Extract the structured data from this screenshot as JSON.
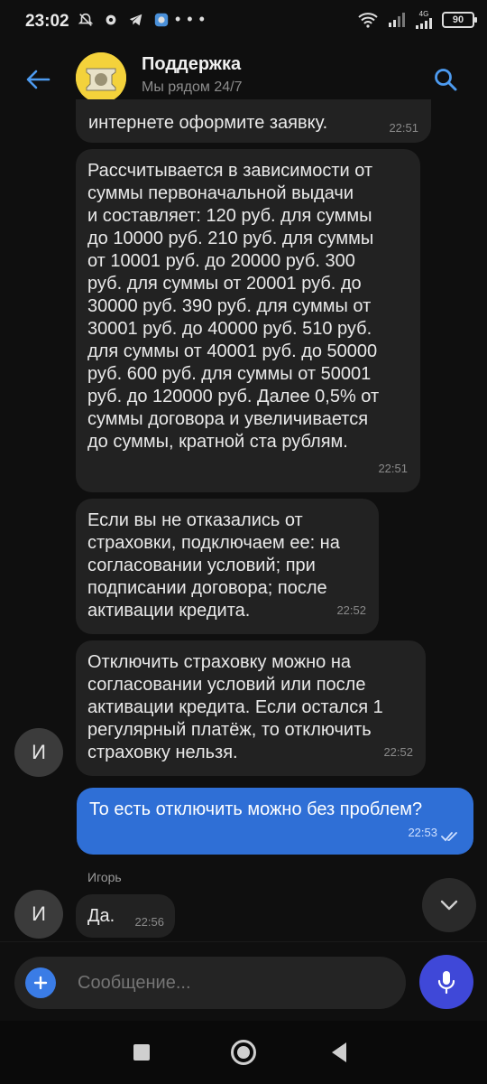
{
  "status_bar": {
    "time": "23:02",
    "battery": "90",
    "network": "4G"
  },
  "header": {
    "title": "Поддержка",
    "subtitle": "Мы рядом 24/7"
  },
  "messages": [
    {
      "text": "интернете оформите заявку.",
      "time": "22:51"
    },
    {
      "text": "Рассчитывается в зависимости от\nсуммы первоначальной выдачи\nи составляет: 120 руб. для суммы\nдо 10000 руб. 210 руб. для суммы\nот 10001 руб. до 20000 руб. 300\nруб. для суммы от 20001 руб. до\n30000 руб. 390 руб. для суммы от\n30001 руб. до 40000 руб. 510 руб.\nдля суммы от 40001 руб. до 50000\nруб. 600 руб. для суммы от 50001\nруб. до 120000 руб. Далее 0,5% от\nсуммы договора и увеличивается\nдо суммы, кратной ста рублям.",
      "time": "22:51"
    },
    {
      "text": "Если вы не отказались от\nстраховки, подключаем ее: на\nсогласовании условий; при\nподписании договора; после\nактивации кредита.",
      "time": "22:52"
    },
    {
      "text": "Отключить страховку можно на\nсогласовании условий или после\nактивации кредита. Если остался 1\nрегулярный платёж, то отключить\nстраховку нельзя.",
      "time": "22:52",
      "avatar_letter": "И"
    },
    {
      "text": "То есть отключить можно без проблем?",
      "time": "22:53",
      "own": true
    },
    {
      "sender": "Игорь",
      "text": "Да.",
      "time": "22:56",
      "avatar_letter": "И"
    }
  ],
  "composer": {
    "placeholder": "Сообщение..."
  },
  "colors": {
    "background": "#0f0f0f",
    "incoming_bubble": "#222222",
    "outgoing_bubble": "#2f6fd6",
    "accent": "#3a7ce6",
    "mic_button": "#3f48d8",
    "support_avatar": "#f4d23b"
  },
  "icons": {
    "back": "arrow-left-icon",
    "search": "search-icon",
    "scroll_down": "chevron-down-icon",
    "attach": "plus-icon",
    "voice": "microphone-icon",
    "read": "double-check-icon"
  }
}
